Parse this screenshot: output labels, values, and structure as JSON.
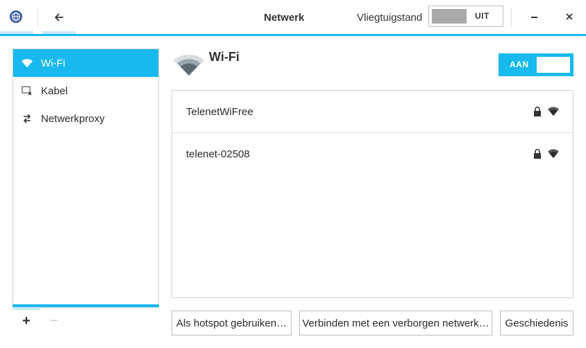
{
  "header": {
    "title": "Netwerk",
    "airplane_mode_label": "Vliegtuigstand",
    "airplane_toggle_state": "UIT"
  },
  "sidebar": {
    "items": [
      {
        "label": "Wi-Fi",
        "icon": "wifi-icon",
        "active": true
      },
      {
        "label": "Kabel",
        "icon": "wired-network-icon",
        "active": false
      },
      {
        "label": "Netwerkproxy",
        "icon": "proxy-arrows-icon",
        "active": false
      }
    ],
    "add_label": "+",
    "remove_label": "−"
  },
  "main": {
    "title": "Wi-Fi",
    "wifi_toggle_state": "AAN",
    "networks": [
      {
        "name": "TelenetWiFree",
        "secured": true,
        "signal": "strong"
      },
      {
        "name": "telenet-02508",
        "secured": true,
        "signal": "strong"
      }
    ],
    "buttons": {
      "hotspot": "Als hotspot gebruiken…",
      "hidden_network": "Verbinden met een verborgen netwerk…",
      "history": "Geschiedenis"
    }
  },
  "colors": {
    "accent": "#17b9ef",
    "accent_light": "#c8eaf8",
    "toggle_off_knob": "#a9a9a9"
  }
}
